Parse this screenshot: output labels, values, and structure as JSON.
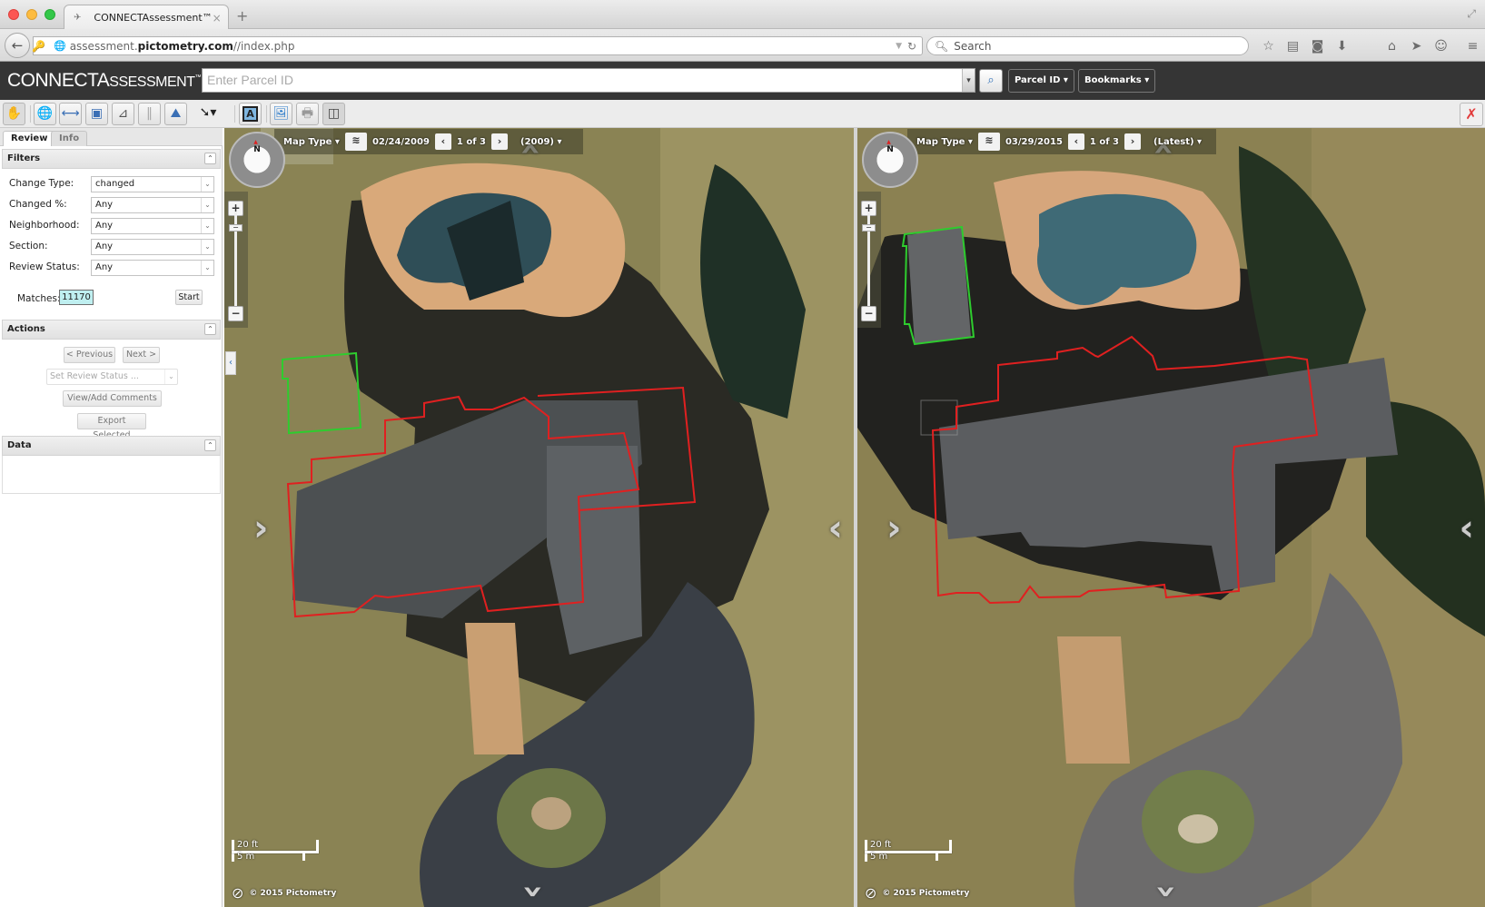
{
  "browser": {
    "tab_title": "CONNECTAssessment™",
    "new_tab": "+",
    "url_host_pre": "assessment.",
    "url_host_domain": "pictometry.com",
    "url_path": "//index.php",
    "search_placeholder": "Search",
    "nav_icons": [
      "bookmark-star-icon",
      "reading-list-icon",
      "pocket-icon",
      "download-icon",
      "home-icon",
      "share-icon",
      "chat-icon",
      "menu-icon"
    ]
  },
  "app": {
    "logo_main": "CONNECTA",
    "logo_rest": "SSESSMENT",
    "logo_tm": "™",
    "parcel_placeholder": "Enter Parcel ID",
    "parcel_id_btn": "Parcel ID ▾",
    "bookmarks_btn": "Bookmarks ▾"
  },
  "toolbar": {
    "tools": [
      "pan-tool",
      "globe-tool",
      "measure-distance-tool",
      "measure-area-tool",
      "measure-height-tool",
      "measure-elevation-tool",
      "terrain-profile-tool",
      "info-pointer-tool",
      "annotation-text-tool",
      "export-image-tool",
      "print-pdf-tool",
      "split-view-tool"
    ]
  },
  "sidebar": {
    "tabs": [
      {
        "label": "Review",
        "active": true
      },
      {
        "label": "Info",
        "active": false
      }
    ],
    "filters": {
      "title": "Filters",
      "rows": [
        {
          "label": "Change Type:",
          "value": "changed"
        },
        {
          "label": "Changed %:",
          "value": "Any"
        },
        {
          "label": "Neighborhood:",
          "value": "Any"
        },
        {
          "label": "Section:",
          "value": "Any"
        },
        {
          "label": "Review Status:",
          "value": "Any"
        }
      ],
      "matches_label": "Matches:",
      "matches_value": "11170",
      "start_label": "Start"
    },
    "actions": {
      "title": "Actions",
      "previous": "< Previous",
      "next": "Next >",
      "set_status_placeholder": "Set Review Status ...",
      "comments": "View/Add Comments ...",
      "export": "Export Selected"
    },
    "data": {
      "title": "Data"
    }
  },
  "maps": [
    {
      "map_type": "Map Type ▾",
      "date": "02/24/2009",
      "page": "1 of 3",
      "year": "(2009) ▾",
      "scale_ft": "20 ft",
      "scale_m": "5 m",
      "copyright": "© 2015 Pictometry",
      "compass": "N"
    },
    {
      "map_type": "Map Type ▾",
      "date": "03/29/2015",
      "page": "1 of 3",
      "year": "(Latest) ▾",
      "scale_ft": "20 ft",
      "scale_m": "5 m",
      "copyright": "© 2015 Pictometry",
      "compass": "N"
    }
  ],
  "colors": {
    "building_outline": "#e02020",
    "accessory_outline": "#2ecc2e",
    "matches_bg": "#bfeff0",
    "header_bg": "#353535"
  }
}
